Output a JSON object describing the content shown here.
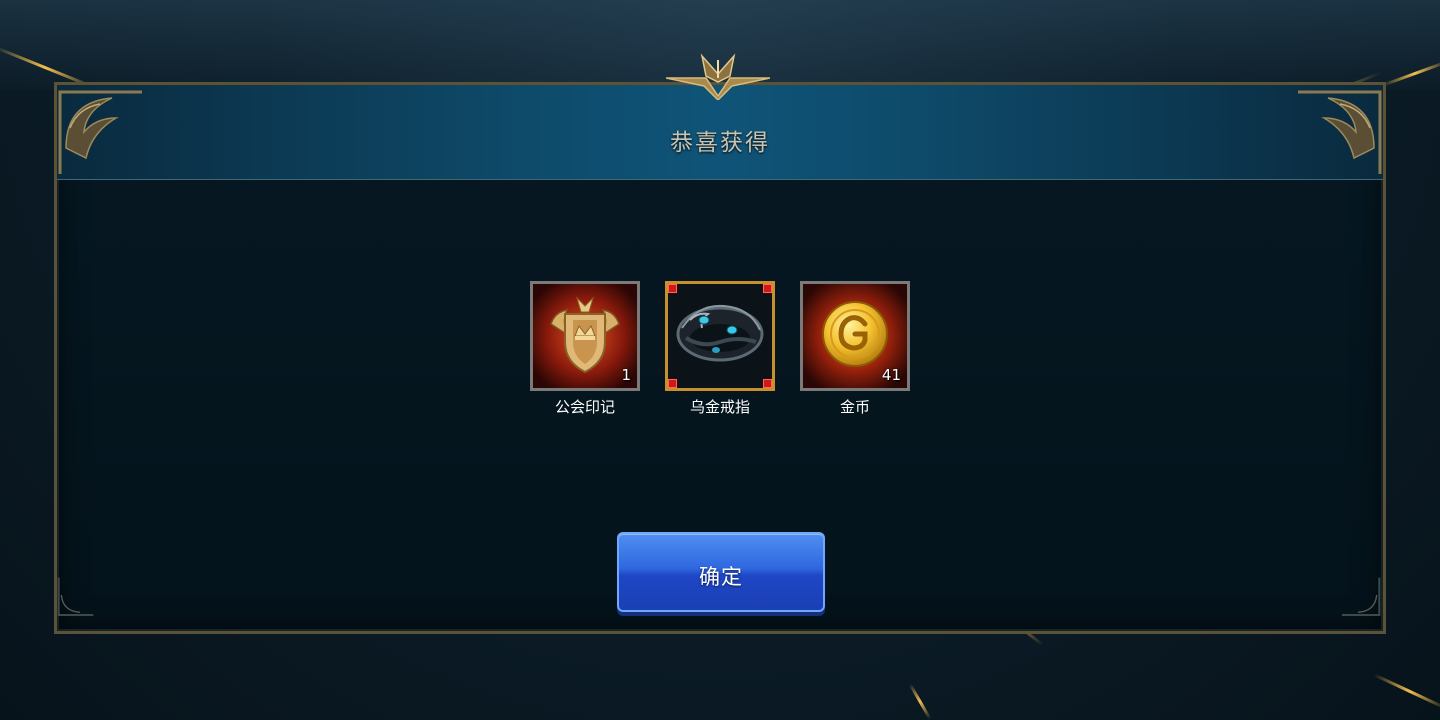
{
  "dialog": {
    "title": "恭喜获得"
  },
  "rewards": [
    {
      "name": "公会印记",
      "count": "1",
      "icon": "guild-emblem-icon",
      "selected": false
    },
    {
      "name": "乌金戒指",
      "count": "",
      "icon": "dark-gold-ring-icon",
      "selected": true
    },
    {
      "name": "金币",
      "count": "41",
      "icon": "gold-coin-icon",
      "selected": false
    }
  ],
  "confirm_button": {
    "label": "确定"
  },
  "colors": {
    "accent_gold": "#c8902c",
    "button_blue": "#2f67e0",
    "panel_dark": "#061823",
    "header_blue": "#0f5478"
  }
}
